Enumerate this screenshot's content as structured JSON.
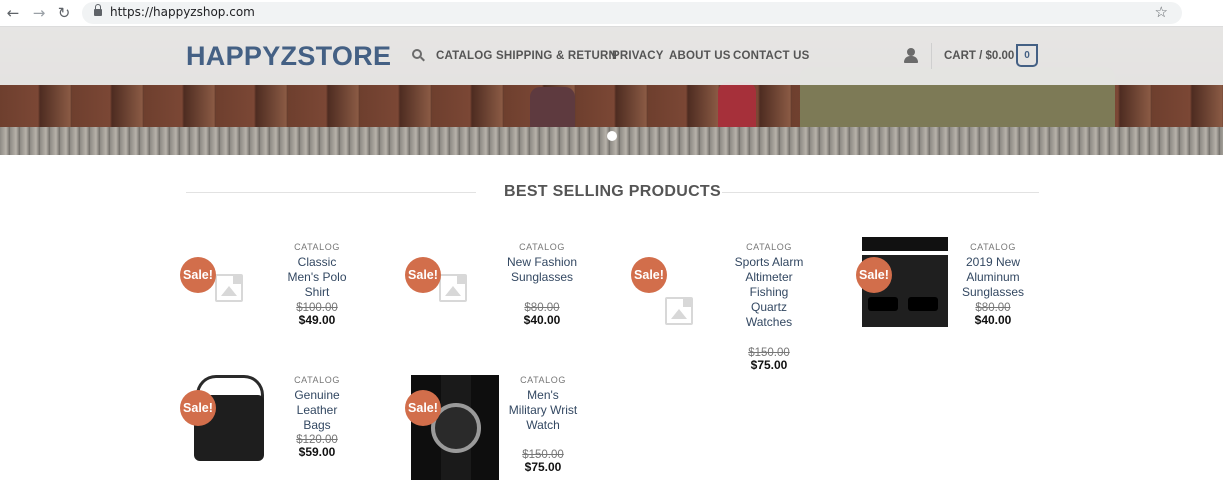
{
  "browser": {
    "url": "https://happyzshop.com",
    "back": "←",
    "forward": "→",
    "reload": "↻",
    "star": "☆"
  },
  "header": {
    "logo": "HAPPYZSTORE",
    "menu": [
      "CATALOG",
      "SHIPPING & RETURN",
      "PRIVACY",
      "ABOUT US",
      "CONTACT US"
    ],
    "cart_label": "CART / $0.00",
    "cart_count": "0"
  },
  "section": {
    "title": "BEST SELLING PRODUCTS"
  },
  "products": [
    {
      "category": "CATALOG",
      "name": "Classic Men's Polo Shirt",
      "old_price": "$100.00",
      "price": "$49.00",
      "badge": "Sale!",
      "image": "placeholder-icon"
    },
    {
      "category": "CATALOG",
      "name": "New Fashion Sunglasses",
      "old_price": "$80.00",
      "price": "$40.00",
      "badge": "Sale!",
      "image": "placeholder-icon"
    },
    {
      "category": "CATALOG",
      "name": "Sports Alarm Altimeter Fishing Quartz Watches",
      "old_price": "$150.00",
      "price": "$75.00",
      "badge": "Sale!",
      "image": "placeholder-icon"
    },
    {
      "category": "CATALOG",
      "name": "2019 New Aluminum Sunglasses",
      "old_price": "$80.00",
      "price": "$40.00",
      "badge": "Sale!",
      "image": "sunglasses-photo"
    },
    {
      "category": "CATALOG",
      "name": "Genuine Leather Bags",
      "old_price": "$120.00",
      "price": "$59.00",
      "badge": "Sale!",
      "image": "leather-bag-photo"
    },
    {
      "category": "CATALOG",
      "name": "Men's Military Wrist Watch",
      "old_price": "$150.00",
      "price": "$75.00",
      "badge": "Sale!",
      "image": "wrist-watch-photo"
    }
  ],
  "colors": {
    "brand": "#446084",
    "sale_badge": "#d26e4b",
    "link": "#334862"
  }
}
